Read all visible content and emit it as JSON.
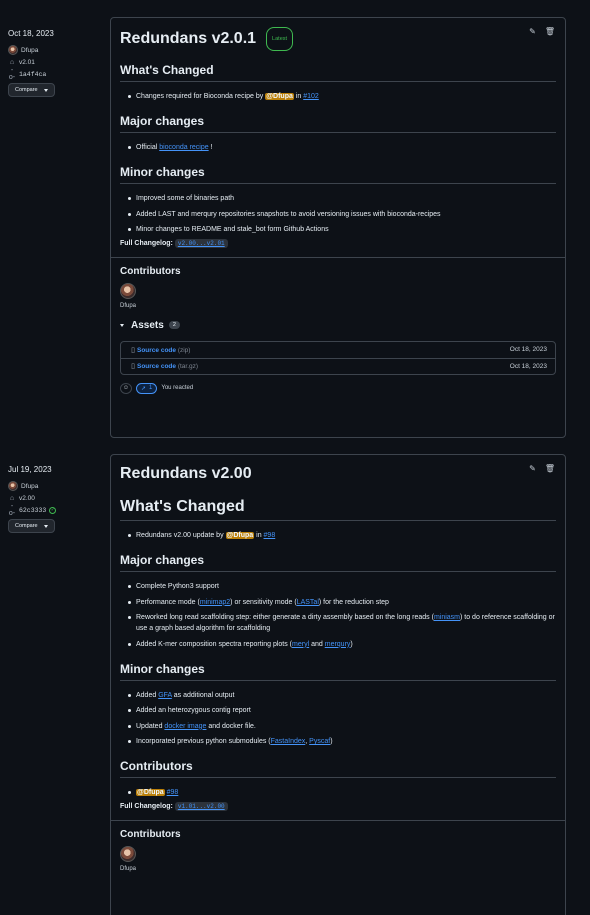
{
  "releases": [
    {
      "date": "Oct 18, 2023",
      "author": "Dfupa",
      "tag": "v2.01",
      "commit": "1a4f4ca",
      "compare_label": "Compare",
      "title": "Redundans v2.0.1",
      "badge": "Latest",
      "whats_changed_heading": "What's Changed",
      "whats_changed": {
        "pre": "Changes required for Bioconda recipe by ",
        "mention": "@Dfupa",
        "mid": " in ",
        "link": "#102"
      },
      "major_heading": "Major changes",
      "major": {
        "pre": "Official ",
        "link": "bioconda recipe",
        "post": " !"
      },
      "minor_heading": "Minor changes",
      "minor": [
        "Improved some of binaries path",
        "Added LAST and merqury repositories snapshots to avoid versioning issues with bioconda-recipes",
        "Minor changes to README and stale_bot form Github Actions"
      ],
      "full_changelog_label": "Full Changelog:",
      "full_changelog_code": "v2.00...v2.01",
      "contributors_heading": "Contributors",
      "contributor": "Dfupa",
      "assets_heading": "Assets",
      "assets_count": "2",
      "assets": [
        {
          "name": "Source code",
          "ext": "(zip)",
          "date": "Oct 18, 2023"
        },
        {
          "name": "Source code",
          "ext": "(tar.gz)",
          "date": "Oct 18, 2023"
        }
      ],
      "reaction_count": "1",
      "reacted_text": "You reacted"
    },
    {
      "date": "Jul 19, 2023",
      "author": "Dfupa",
      "tag": "v2.00",
      "commit": "62c3333",
      "compare_label": "Compare",
      "title": "Redundans v2.00",
      "whats_changed_heading": "What's Changed",
      "whats_changed": {
        "pre": "Redundans v2.00 update by ",
        "mention": "@Dfupa",
        "mid": " in ",
        "link": "#98"
      },
      "major_heading": "Major changes",
      "major_items": {
        "m1": "Complete Python3 support",
        "m2_pre": "Performance mode (",
        "m2_l1": "minimap2",
        "m2_mid": ") or sensitivity mode (",
        "m2_l2": "LASTal",
        "m2_post": ") for the reduction step",
        "m3_pre": "Reworked long read scaffolding step: either generate a dirty assembly based on the long reads (",
        "m3_l1": "miniasm",
        "m3_post": ") to do reference scaffolding or use a graph based algorithm for scaffolding",
        "m4_pre": "Added K-mer composition spectra reporting plots (",
        "m4_l1": "meryl",
        "m4_mid": " and ",
        "m4_l2": "merqury",
        "m4_post": ")"
      },
      "minor_heading": "Minor changes",
      "minor_items": {
        "n1_pre": "Added ",
        "n1_l": "GFA",
        "n1_post": " as additional output",
        "n2": "Added an heterozygous contig report",
        "n3_pre": "Updated ",
        "n3_l": "docker image",
        "n3_post": " and docker file.",
        "n4_pre": "Incorporated previous python submodules (",
        "n4_l1": "FastaIndex",
        "n4_mid": ", ",
        "n4_l2": "Pyscaf",
        "n4_post": ")"
      },
      "contributors_heading_body": "Contributors",
      "contrib_mention": "@Dfupa",
      "contrib_link": "#98",
      "full_changelog_label": "Full Changelog:",
      "full_changelog_code": "v1.01...v2.00",
      "contributors_heading": "Contributors",
      "contributor": "Dfupa"
    }
  ]
}
